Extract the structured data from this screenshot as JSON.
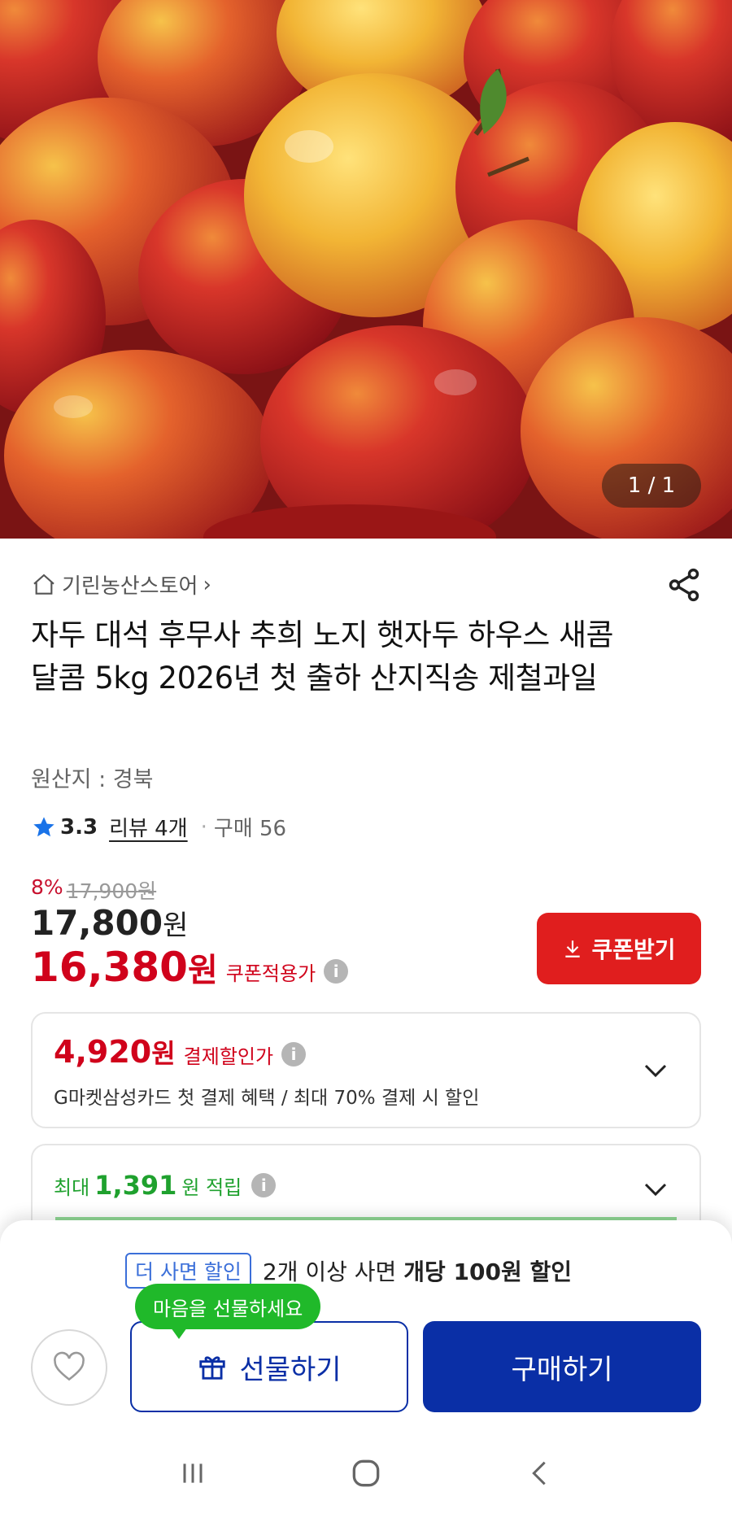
{
  "hero": {
    "counter": "1 / 1"
  },
  "store": {
    "name": "기린농산스토어",
    "arrow": "›"
  },
  "product": {
    "title": "자두 대석 후무사 추희 노지 햇자두 하우스 새콤달콤 5kg 2026년 첫 출하 산지직송 제철과일",
    "origin": "원산지 : 경북"
  },
  "rating": {
    "score": "3.3",
    "reviews": "리뷰 4개",
    "dot": "·",
    "purchases": "구매 56"
  },
  "price": {
    "discount_rate": "8%",
    "original_amount": "17,900",
    "original_unit": "원",
    "current_amount": "17,800",
    "current_unit": "원",
    "coupon_amount": "16,380",
    "coupon_unit": "원",
    "coupon_label": "쿠폰적용가"
  },
  "coupon_button": {
    "label": "쿠폰받기"
  },
  "payment_card": {
    "amount": "4,920",
    "unit": "원",
    "label": "결제할인가",
    "benefit": "G마켓삼성카드 첫 결제 혜택 / 최대 70% 결제 시 할인"
  },
  "points_card": {
    "prefix": "최대",
    "amount": "1,391",
    "suffix": "원 적립"
  },
  "info_glyph": "i",
  "bottom": {
    "promo_badge": "더 사면 할인",
    "promo_text_plain": "2개 이상 사면 ",
    "promo_text_bold": "개당 100원 할인",
    "gift_tooltip": "마음을 선물하세요",
    "gift_label": "선물하기",
    "buy_label": "구매하기"
  },
  "colors": {
    "brand_blue": "#0a2fa6",
    "sale_red": "#d0021b",
    "coupon_red": "#e01e1e",
    "point_green": "#1fa12e",
    "tip_green": "#20b92a"
  },
  "icons": [
    "home-icon",
    "share-icon",
    "star-icon",
    "info-icon",
    "download-icon",
    "chevron-down-icon",
    "heart-icon",
    "gift-icon",
    "recents-icon",
    "home-circle-icon",
    "back-icon"
  ]
}
